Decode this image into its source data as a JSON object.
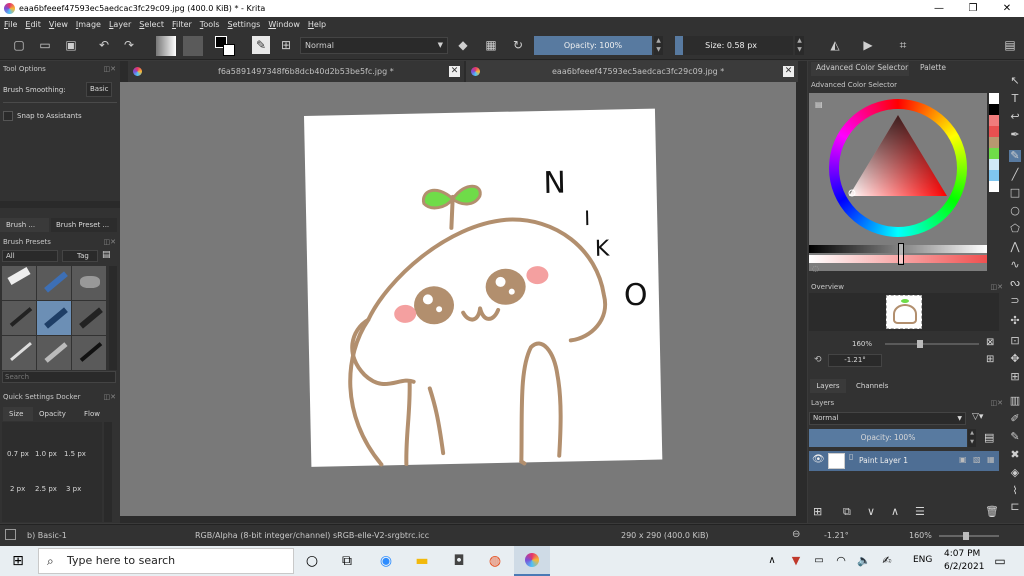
{
  "window": {
    "title": "eaa6bfeeef47593ec5aedcac3fc29c09.jpg (400.0 KiB)  * - Krita",
    "minimize": "—",
    "maximize": "❐",
    "close": "✕"
  },
  "menu": [
    "File",
    "Edit",
    "View",
    "Image",
    "Layer",
    "Select",
    "Filter",
    "Tools",
    "Settings",
    "Window",
    "Help"
  ],
  "toolbar": {
    "blend_mode": "Normal",
    "opacity_label": "Opacity: 100%",
    "size_label": "Size: 0.58 px"
  },
  "tool_options": {
    "title": "Tool Options",
    "brush_smoothing_label": "Brush Smoothing:",
    "brush_smoothing_value": "Basic",
    "snap_to_assistants": "Snap to Assistants"
  },
  "brush_presets": {
    "tab_1": "Brush ...",
    "tab_2": "Brush Preset ...",
    "title": "Brush Presets",
    "filter": "All",
    "tag": "Tag",
    "search_placeholder": "Search"
  },
  "quick_settings": {
    "title": "Quick Settings Docker",
    "tabs": [
      "Size",
      "Opacity",
      "Flow"
    ],
    "sizes_row1": [
      "0.7 px",
      "1.0 px",
      "1.5 px"
    ],
    "sizes_row2": [
      "2 px",
      "2.5 px",
      "3 px"
    ]
  },
  "tabs": [
    {
      "label": "f6a5891497348f6b8dcb40d2b53be5fc.jpg *"
    },
    {
      "label": "eaa6bfeeef47593ec5aedcac3fc29c09.jpg *"
    }
  ],
  "canvas": {
    "letters": [
      "N",
      "I",
      "K",
      "O"
    ]
  },
  "right_panel": {
    "tab_advanced": "Advanced Color Selector",
    "tab_palette": "Palette",
    "advanced_title": "Advanced Color Selector",
    "overview_title": "Overview",
    "zoom": "160%",
    "rotation": "-1.21°",
    "layers_tab": "Layers",
    "channels_tab": "Channels",
    "layers_title": "Layers",
    "blend_mode": "Normal",
    "opacity": "Opacity:  100%",
    "layer_name": "Paint Layer 1"
  },
  "palette_colors": [
    "#ffffff",
    "#000000",
    "#f07c7c",
    "#e85050",
    "#b89870",
    "#6fdc49",
    "#cfe8f7",
    "#7fc6f0",
    "#ffffff"
  ],
  "status": {
    "brush": "b) Basic-1",
    "color_space": "RGB/Alpha (8-bit integer/channel)  sRGB-elle-V2-srgbtrc.icc",
    "dimensions": "290 x 290 (400.0 KiB)",
    "rotation": "-1.21°",
    "zoom": "160%"
  },
  "taskbar": {
    "search_placeholder": "Type here to search",
    "language": "ENG",
    "time": "4:07 PM",
    "date": "6/2/2021"
  }
}
